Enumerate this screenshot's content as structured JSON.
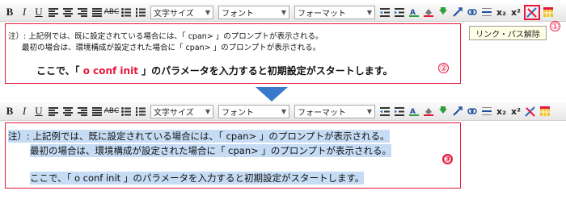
{
  "toolbar": {
    "font_size_select": "文字サイズ",
    "font_select": "フォント",
    "format_select": "フォーマット",
    "icons": [
      "bold-icon",
      "italic-icon",
      "underline-icon",
      "align-left-icon",
      "align-center-icon",
      "align-right-icon",
      "justify-icon",
      "strikethrough-icon",
      "bullet-list-icon",
      "numbered-list-icon",
      "outdent-icon",
      "indent-icon",
      "text-color-icon",
      "background-color-icon",
      "insert-image-icon",
      "link-icon",
      "unlink-icon",
      "horizontal-rule-icon",
      "subscript-icon",
      "superscript-icon",
      "clear-format-icon",
      "table-icon"
    ],
    "bold_label": "B",
    "italic_label": "I",
    "underline_label": "U",
    "strike_label": "ABC",
    "sub_label": "x₂",
    "sup_label": "x²"
  },
  "tooltip": "リンク・パス解除",
  "callouts": {
    "one": "①",
    "two": "②",
    "three": "③"
  },
  "editor_before": {
    "line1": "注）: 上記例では、既に設定されている場合には、「 cpan> 」のプロンプトが表示される。",
    "line2": "最初の場合は、環境構成が設定された場合に「 cpan> 」のプロンプトが表示される。",
    "line3_pre": "ここで、「",
    "line3_cmd": " o conf init ",
    "line3_post": "」のパラメータを入力すると初期設定がスタートします。"
  },
  "editor_after": {
    "line1": "注）: 上記例では、既に設定されている場合には、「 cpan> 」のプロンプトが表示される。",
    "line2": "最初の場合は、環境構成が設定された場合に「 cpan> 」のプロンプトが表示される。",
    "line3": "ここで、「 o conf init 」のパラメータを入力すると初期設定がスタートします。"
  },
  "colors": {
    "accent_red": "#e8163a",
    "selection_blue": "#c5dcf4",
    "arrow_blue": "#3a78c9"
  }
}
